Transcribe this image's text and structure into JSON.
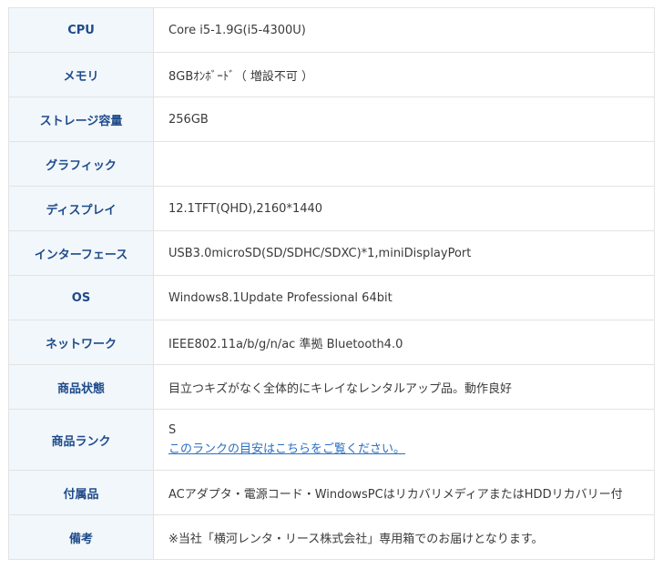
{
  "specs": [
    {
      "label": "CPU",
      "value": "Core i5-1.9G(i5-4300U)"
    },
    {
      "label": "メモリ",
      "value": "8GBｵﾝﾎﾞｰﾄﾞ（ 増設不可 ）"
    },
    {
      "label": "ストレージ容量",
      "value": "256GB"
    },
    {
      "label": "グラフィック",
      "value": ""
    },
    {
      "label": "ディスプレイ",
      "value": "12.1TFT(QHD),2160*1440"
    },
    {
      "label": "インターフェース",
      "value": "USB3.0microSD(SD/SDHC/SDXC)*1,miniDisplayPort"
    },
    {
      "label": "OS",
      "value": "Windows8.1Update Professional 64bit"
    },
    {
      "label": "ネットワーク",
      "value": "IEEE802.11a/b/g/n/ac 準拠 Bluetooth4.0"
    },
    {
      "label": "商品状態",
      "value": "目立つキズがなく全体的にキレイなレンタルアップ品。動作良好"
    },
    {
      "label": "商品ランク",
      "value": "S",
      "link": "このランクの目安はこちらをご覧ください。"
    },
    {
      "label": "付属品",
      "value": "ACアダプタ・電源コード・WindowsPCはリカバリメディアまたはHDDリカバリー付"
    },
    {
      "label": "備考",
      "value": "※当社「横河レンタ・リース株式会社」専用箱でのお届けとなります。"
    }
  ]
}
